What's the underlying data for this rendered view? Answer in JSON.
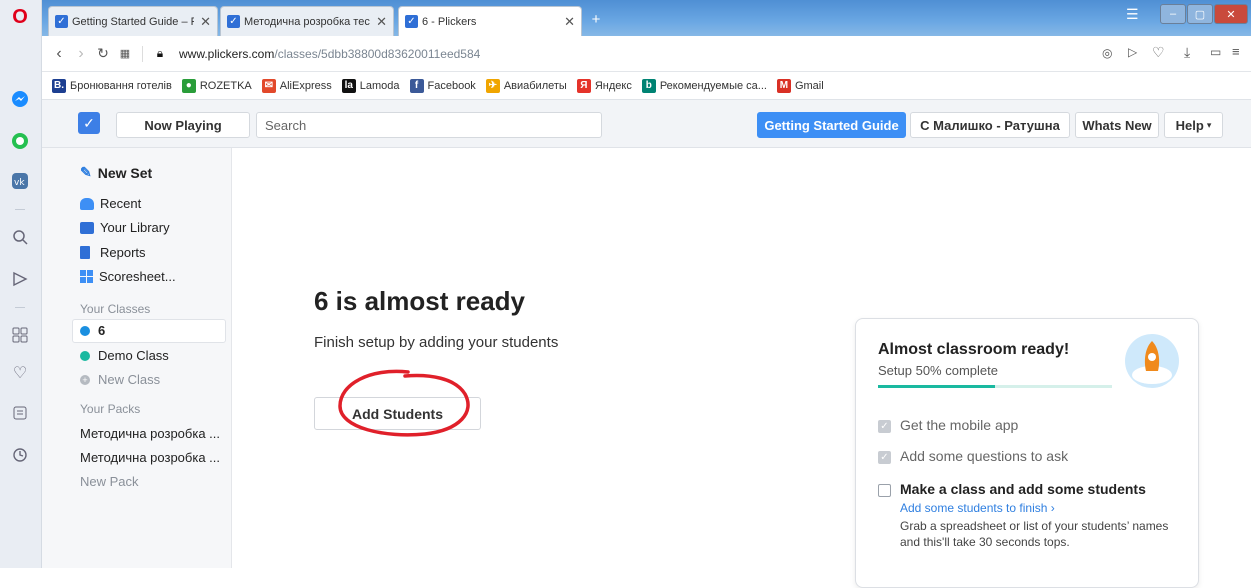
{
  "browser": {
    "tabs": [
      {
        "title": "Getting Started Guide – Pli"
      },
      {
        "title": "Методична розробка тест"
      },
      {
        "title": "6 - Plickers"
      }
    ],
    "url_domain": "www.plickers.com",
    "url_path": "/classes/5dbb38800d83620011eed584",
    "bookmarks": [
      {
        "label": "Бронювання готелів",
        "icon": "B.",
        "color": "#1d3f91"
      },
      {
        "label": "ROZETKA",
        "icon": "●",
        "color": "#2a9d3a"
      },
      {
        "label": "AliExpress",
        "icon": "✉",
        "color": "#e2492b"
      },
      {
        "label": "Lamoda",
        "icon": "la",
        "color": "#111111"
      },
      {
        "label": "Facebook",
        "icon": "f",
        "color": "#3b5998"
      },
      {
        "label": "Авиабилеты",
        "icon": "✈",
        "color": "#f0a500"
      },
      {
        "label": "Яндекс",
        "icon": "Я",
        "color": "#e5332a"
      },
      {
        "label": "Рекомендуемые са...",
        "icon": "b",
        "color": "#008373"
      },
      {
        "label": "Gmail",
        "icon": "M",
        "color": "#d93025"
      }
    ]
  },
  "topbar": {
    "now_playing": "Now Playing",
    "search_placeholder": "Search",
    "getting_started": "Getting Started Guide",
    "user": "С Малишко - Ратушна",
    "whats_new": "Whats New",
    "help": "Help"
  },
  "nav": {
    "new_set": "New Set",
    "recent": "Recent",
    "library": "Your Library",
    "reports": "Reports",
    "scoresheet": "Scoresheet...",
    "classes_header": "Your Classes",
    "classes": [
      {
        "label": "6",
        "dot_color": "#1a8fe0"
      },
      {
        "label": "Demo Class",
        "dot_color": "#1ab9a0"
      }
    ],
    "new_class": "New Class",
    "packs_header": "Your Packs",
    "packs": [
      "Методична розробка ...",
      "Методична розробка ..."
    ],
    "new_pack": "New Pack"
  },
  "main": {
    "title": "6 is almost ready",
    "subtitle": "Finish setup by adding your students",
    "add_students": "Add Students"
  },
  "card": {
    "title": "Almost classroom ready!",
    "progress_text": "Setup 50% complete",
    "progress_fraction": 0.5,
    "items": [
      {
        "label": "Get the mobile app",
        "done": true
      },
      {
        "label": "Add some questions to ask",
        "done": true
      },
      {
        "label": "Make a class and add some students",
        "done": false
      }
    ],
    "link": "Add some students to finish ›",
    "description": "Grab a spreadsheet or list of your students’ names and this'll take 30 seconds tops."
  },
  "colors": {
    "accent": "#3d8ff5",
    "annotation": "#e0202a"
  }
}
